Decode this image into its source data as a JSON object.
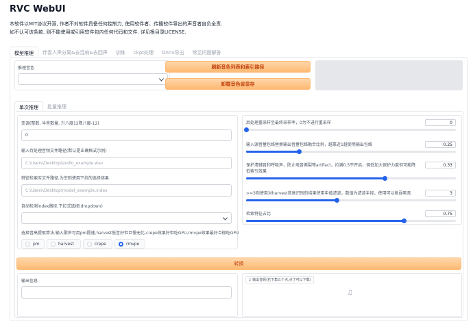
{
  "app": {
    "title": "RVC WebUI",
    "desc1": "本软件以MIT协议开源, 作者不对软件具备任何控制力, 使用软件者、传播软件导出的声音者自负全责.",
    "desc2": "如不认可该条款, 则不能使用或引用软件包内任何代码和文件. 详见根目录LICENSE."
  },
  "tabs": [
    "模型推理",
    "伴奏人声分离&去混响&去回声",
    "训练",
    "ckpt处理",
    "Onnx导出",
    "常见问题解答"
  ],
  "voice": {
    "label": "推理音色",
    "value": "",
    "refresh_button": "刷新音色列表和索引路径",
    "unload_button": "卸载音色省显存"
  },
  "subtabs": [
    "单次推理",
    "批量推理"
  ],
  "single": {
    "pitch_label": "变调(整数, 半音数量, 升八度12降八度-12)",
    "pitch_value": "0",
    "input_path_label": "输入待处理音频文件路径(默认是正确格式示例)",
    "input_path_placeholder": "C:\\Users\\Desktop\\audio_example.wav",
    "index_path_label": "特征检索库文件路径,为空则使用下拉的选择结果",
    "index_path_placeholder": "C:\\Users\\Desktop\\model_example.index",
    "auto_index_label": "自动检测index路径,下拉式选择(dropdown)",
    "auto_index_value": "",
    "f0_label": "选择音高提取算法,输入歌声可用pm提速,harvest低音好但巨慢无比,crepe效果好但吃GPU,rmvpe效果最好且微吃GPU",
    "f0_options": [
      "pm",
      "harvest",
      "crepe",
      "rmvpe"
    ],
    "f0_selected": "rmvpe"
  },
  "sliders": [
    {
      "label": "后处理重采样至最终采样率，0为不进行重采样",
      "value": "0",
      "fraction": 0.0
    },
    {
      "label": "输入源音量包络替换输出音量包络融合比例，越靠近1越使用输出包络",
      "value": "0.25",
      "fraction": 0.25
    },
    {
      "label": "保护清辅音和呼吸声，防止电音撕裂等artifact，拉满0.5不开启，调低加大保护力度但可能降低索引效果",
      "value": "0.33",
      "fraction": 0.66
    },
    {
      "label": ">=3则使用对harvest音高识别的结果使用中值滤波，数值为滤波半径，使用可以削弱哑音",
      "value": "3",
      "fraction": 0.43
    },
    {
      "label": "检索特征占比",
      "value": "0.75",
      "fraction": 0.75
    }
  ],
  "convert_button": "转换",
  "output": {
    "info_label": "输出信息",
    "info_value": "",
    "audio_label": "输出音频(右下角三个点,点了可以下载)"
  },
  "colors": {
    "accent": "#2563eb",
    "orange_button_text": "#c2410c",
    "orange_button_bg": "#fdba74"
  }
}
